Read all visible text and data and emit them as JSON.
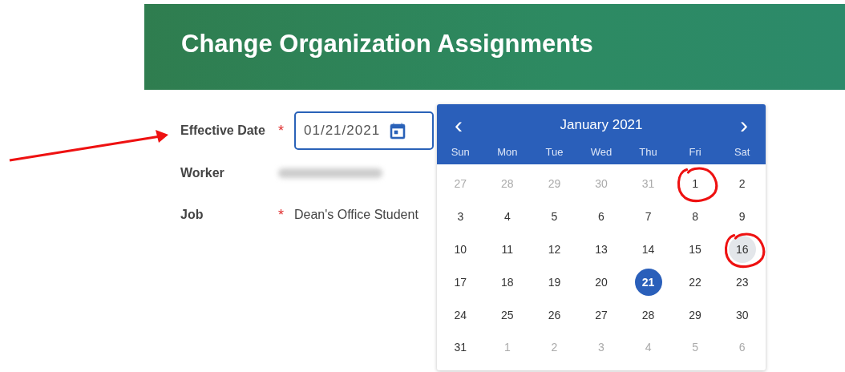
{
  "header": {
    "title": "Change Organization Assignments"
  },
  "fields": [
    {
      "kind": "date",
      "label": "Effective Date",
      "required_mark": "*",
      "value": "01/21/2021",
      "focused": true
    },
    {
      "kind": "redacted",
      "label": "Worker"
    },
    {
      "kind": "text",
      "label": "Job",
      "required_mark": "*",
      "value": "Dean's Office Student"
    }
  ],
  "calendar": {
    "month": "January 2021",
    "prev": "‹",
    "next": "›",
    "weekdays": [
      "Sun",
      "Mon",
      "Tue",
      "Wed",
      "Thu",
      "Fri",
      "Sat"
    ],
    "days": [
      {
        "label": "27",
        "in_month": false,
        "selected": false,
        "hovered": false,
        "circled": false
      },
      {
        "label": "28",
        "in_month": false,
        "selected": false,
        "hovered": false,
        "circled": false
      },
      {
        "label": "29",
        "in_month": false,
        "selected": false,
        "hovered": false,
        "circled": false
      },
      {
        "label": "30",
        "in_month": false,
        "selected": false,
        "hovered": false,
        "circled": false
      },
      {
        "label": "31",
        "in_month": false,
        "selected": false,
        "hovered": false,
        "circled": false
      },
      {
        "label": "1",
        "in_month": true,
        "selected": false,
        "hovered": false,
        "circled": true
      },
      {
        "label": "2",
        "in_month": true,
        "selected": false,
        "hovered": false,
        "circled": false
      },
      {
        "label": "3",
        "in_month": true,
        "selected": false,
        "hovered": false,
        "circled": false
      },
      {
        "label": "4",
        "in_month": true,
        "selected": false,
        "hovered": false,
        "circled": false
      },
      {
        "label": "5",
        "in_month": true,
        "selected": false,
        "hovered": false,
        "circled": false
      },
      {
        "label": "6",
        "in_month": true,
        "selected": false,
        "hovered": false,
        "circled": false
      },
      {
        "label": "7",
        "in_month": true,
        "selected": false,
        "hovered": false,
        "circled": false
      },
      {
        "label": "8",
        "in_month": true,
        "selected": false,
        "hovered": false,
        "circled": false
      },
      {
        "label": "9",
        "in_month": true,
        "selected": false,
        "hovered": false,
        "circled": false
      },
      {
        "label": "10",
        "in_month": true,
        "selected": false,
        "hovered": false,
        "circled": false
      },
      {
        "label": "11",
        "in_month": true,
        "selected": false,
        "hovered": false,
        "circled": false
      },
      {
        "label": "12",
        "in_month": true,
        "selected": false,
        "hovered": false,
        "circled": false
      },
      {
        "label": "13",
        "in_month": true,
        "selected": false,
        "hovered": false,
        "circled": false
      },
      {
        "label": "14",
        "in_month": true,
        "selected": false,
        "hovered": false,
        "circled": false
      },
      {
        "label": "15",
        "in_month": true,
        "selected": false,
        "hovered": false,
        "circled": false
      },
      {
        "label": "16",
        "in_month": true,
        "selected": false,
        "hovered": true,
        "circled": true
      },
      {
        "label": "17",
        "in_month": true,
        "selected": false,
        "hovered": false,
        "circled": false
      },
      {
        "label": "18",
        "in_month": true,
        "selected": false,
        "hovered": false,
        "circled": false
      },
      {
        "label": "19",
        "in_month": true,
        "selected": false,
        "hovered": false,
        "circled": false
      },
      {
        "label": "20",
        "in_month": true,
        "selected": false,
        "hovered": false,
        "circled": false
      },
      {
        "label": "21",
        "in_month": true,
        "selected": true,
        "hovered": false,
        "circled": false
      },
      {
        "label": "22",
        "in_month": true,
        "selected": false,
        "hovered": false,
        "circled": false
      },
      {
        "label": "23",
        "in_month": true,
        "selected": false,
        "hovered": false,
        "circled": false
      },
      {
        "label": "24",
        "in_month": true,
        "selected": false,
        "hovered": false,
        "circled": false
      },
      {
        "label": "25",
        "in_month": true,
        "selected": false,
        "hovered": false,
        "circled": false
      },
      {
        "label": "26",
        "in_month": true,
        "selected": false,
        "hovered": false,
        "circled": false
      },
      {
        "label": "27",
        "in_month": true,
        "selected": false,
        "hovered": false,
        "circled": false
      },
      {
        "label": "28",
        "in_month": true,
        "selected": false,
        "hovered": false,
        "circled": false
      },
      {
        "label": "29",
        "in_month": true,
        "selected": false,
        "hovered": false,
        "circled": false
      },
      {
        "label": "30",
        "in_month": true,
        "selected": false,
        "hovered": false,
        "circled": false
      },
      {
        "label": "31",
        "in_month": true,
        "selected": false,
        "hovered": false,
        "circled": false
      },
      {
        "label": "1",
        "in_month": false,
        "selected": false,
        "hovered": false,
        "circled": false
      },
      {
        "label": "2",
        "in_month": false,
        "selected": false,
        "hovered": false,
        "circled": false
      },
      {
        "label": "3",
        "in_month": false,
        "selected": false,
        "hovered": false,
        "circled": false
      },
      {
        "label": "4",
        "in_month": false,
        "selected": false,
        "hovered": false,
        "circled": false
      },
      {
        "label": "5",
        "in_month": false,
        "selected": false,
        "hovered": false,
        "circled": false
      },
      {
        "label": "6",
        "in_month": false,
        "selected": false,
        "hovered": false,
        "circled": false
      }
    ]
  },
  "annotations": [
    {
      "kind": "arrow"
    }
  ]
}
